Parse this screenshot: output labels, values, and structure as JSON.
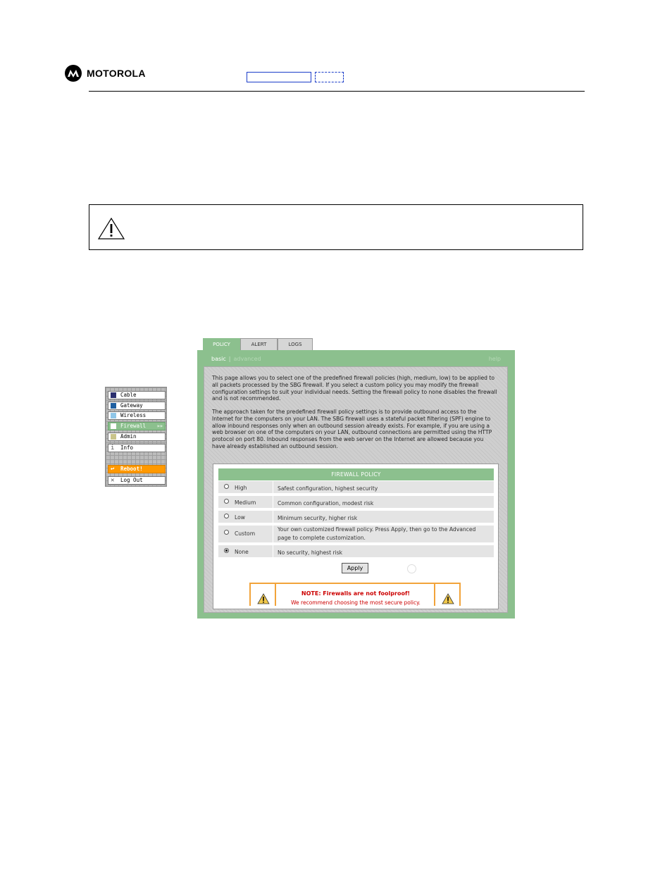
{
  "header": {
    "brand": "MOTOROLA"
  },
  "nav": {
    "items": [
      {
        "label": "Cable",
        "color": "#2b2f6e"
      },
      {
        "label": "Gateway",
        "color": "#1f5fa0"
      },
      {
        "label": "Wireless",
        "color": "#8fc6e8"
      },
      {
        "label": "Firewall",
        "color": "#ffffff",
        "active": true,
        "chevron": "»»"
      },
      {
        "label": "Admin",
        "color": "#c9c48a"
      },
      {
        "label": "Info",
        "icon": "info-icon"
      },
      {
        "label": "Reboot!",
        "icon": "reboot-icon"
      },
      {
        "label": "Log Out",
        "icon": "close-icon"
      }
    ]
  },
  "tabs": [
    "POLICY",
    "ALERT",
    "LOGS"
  ],
  "subnav": {
    "basic": "basic",
    "advanced": "advanced",
    "help": "help"
  },
  "intro": {
    "p1": "This page allows you to select one of the predefined firewall policies (high, medium, low) to be applied to all packets processed by the SBG firewall. If you select a custom policy you may modify the firewall configuration settings to suit your individual needs. Setting the firewall policy to none disables the firewall and is not recommended.",
    "p2": "The approach taken for the predefined firewall policy settings is to provide outbound access to the Internet for the computers on your LAN. The SBG firewall uses a stateful packet filtering (SPF) engine to allow inbound responses only when an outbound session already exists. For example, if you are using a web browser on one of the computers on your LAN, outbound connections are permitted using the HTTP protocol on port 80. Inbound responses from the web server on the Internet are allowed because you have already established an outbound session."
  },
  "firewall_policy": {
    "title": "FIREWALL POLICY",
    "options": [
      {
        "label": "High",
        "desc": "Safest configuration, highest security",
        "selected": false
      },
      {
        "label": "Medium",
        "desc": "Common configuration, modest risk",
        "selected": false
      },
      {
        "label": "Low",
        "desc": "Minimum security, higher risk",
        "selected": false
      },
      {
        "label": "Custom",
        "desc": "Your own customized firewall policy. Press Apply, then go to the Advanced page to complete customization.",
        "selected": false
      },
      {
        "label": "None",
        "desc": "No security, highest risk",
        "selected": true
      }
    ],
    "apply": "Apply"
  },
  "note": {
    "title": "NOTE: Firewalls are not foolproof!",
    "text": "We recommend choosing the most secure policy."
  },
  "colors": {
    "accent_green": "#8cc08e",
    "warning_orange": "#ff9900",
    "warning_red": "#cc0000",
    "link_blue": "#1a3cc9"
  }
}
